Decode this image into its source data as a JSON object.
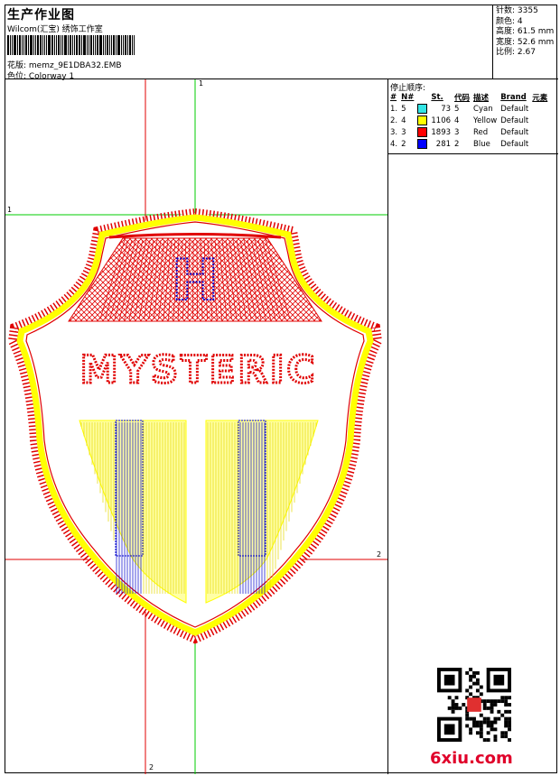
{
  "header": {
    "title": "生产作业图",
    "company": "Wilcom(汇宝) 绣饰工作室",
    "design_label": "花版: memz_9E1DBA32.EMB",
    "colorway_label": "色位:  Colorway 1"
  },
  "stats": {
    "stitches": "针数: 3355",
    "colors": "颜色: 4",
    "height": "高度: 61.5 mm",
    "width": "宽度: 52.6 mm",
    "scale": "比例: 2.67"
  },
  "stop_sequence": {
    "title": "停止顺序:",
    "headers": [
      "#",
      "N#",
      "St.",
      "代码",
      "描述",
      "Brand",
      "元素"
    ],
    "rows": [
      {
        "num": "1.",
        "n": "5",
        "color": "#33e5e5",
        "st": "73",
        "code": "5",
        "desc": "Cyan",
        "brand": "Default"
      },
      {
        "num": "2.",
        "n": "4",
        "color": "#ffff00",
        "st": "1106",
        "code": "4",
        "desc": "Yellow",
        "brand": "Default"
      },
      {
        "num": "3.",
        "n": "3",
        "color": "#ff0000",
        "st": "1893",
        "code": "3",
        "desc": "Red",
        "brand": "Default"
      },
      {
        "num": "4.",
        "n": "2",
        "color": "#0000ff",
        "st": "281",
        "code": "2",
        "desc": "Blue",
        "brand": "Default"
      }
    ]
  },
  "design": {
    "embroidered_text": "MYSTERIC",
    "monogram": "H"
  },
  "axis_markers": {
    "top_green": "1",
    "left_green": "1",
    "right_red": "2",
    "bottom_red": "2"
  },
  "watermark": "6xiu.com",
  "colors": {
    "red": "#e00000",
    "yellow": "#ffff00",
    "blue": "#0000cc",
    "guide_green": "#00cc00",
    "guide_red": "#e00000"
  }
}
